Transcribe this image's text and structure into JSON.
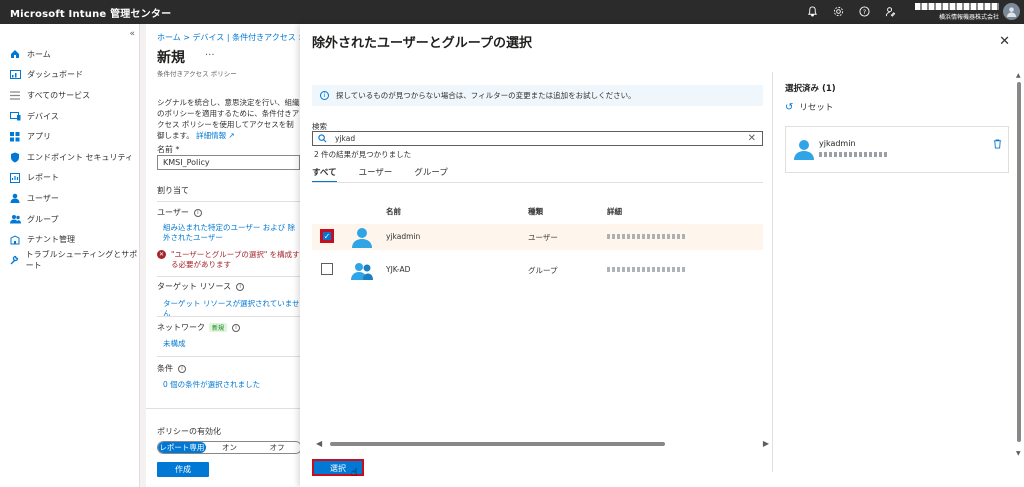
{
  "topbar": {
    "title": "Microsoft Intune 管理センター",
    "org": "横浜情報機器株式会社"
  },
  "nav": {
    "items": [
      {
        "label": "ホーム",
        "icon": "home-icon"
      },
      {
        "label": "ダッシュボード",
        "icon": "dashboard-icon"
      },
      {
        "label": "すべてのサービス",
        "icon": "list-icon"
      },
      {
        "label": "デバイス",
        "icon": "devices-icon"
      },
      {
        "label": "アプリ",
        "icon": "apps-icon"
      },
      {
        "label": "エンドポイント セキュリティ",
        "icon": "shield-icon"
      },
      {
        "label": "レポート",
        "icon": "reports-icon"
      },
      {
        "label": "ユーザー",
        "icon": "user-icon"
      },
      {
        "label": "グループ",
        "icon": "group-icon"
      },
      {
        "label": "テナント管理",
        "icon": "tenant-icon"
      },
      {
        "label": "トラブルシューティングとサポート",
        "icon": "wrench-icon"
      }
    ]
  },
  "policy": {
    "breadcrumb": "ホーム > デバイス | 条件付きアクセス >",
    "title": "新規",
    "subtitle": "条件付きアクセス ポリシー",
    "description": "シグナルを統合し、意思決定を行い、組織のポリシーを適用するために、条件付きアクセス ポリシーを使用してアクセスを制御します。",
    "learn_more": "詳細情報",
    "name_label": "名前 *",
    "name_value": "KMSI_Policy",
    "assignments": "割り当て",
    "users_label": "ユーザー",
    "users_link": "組み込まれた特定のユーザー および 除外されたユーザー",
    "users_error": "\"ユーザーとグループの選択\" を構成する必要があります",
    "target_label": "ターゲット リソース",
    "target_link": "ターゲット リソースが選択されていません",
    "network_label": "ネットワーク",
    "network_badge": "新規",
    "network_link": "未構成",
    "conditions_label": "条件",
    "conditions_link": "0 個の条件が選択されました",
    "enable_label": "ポリシーの有効化",
    "toggle": [
      "レポート専用",
      "オン",
      "オフ"
    ],
    "create_button": "作成"
  },
  "modal": {
    "title": "除外されたユーザーとグループの選択",
    "banner": "探しているものが見つからない場合は、フィルターの変更または追加をお試しください。",
    "search_label": "検索",
    "search_value": "yjkad",
    "results": "2 件の結果が見つかりました",
    "tabs": [
      "すべて",
      "ユーザー",
      "グループ"
    ],
    "columns": [
      "名前",
      "種類",
      "詳細"
    ],
    "rows": [
      {
        "name": "yjkadmin",
        "type": "ユーザー",
        "checked": true
      },
      {
        "name": "YJK-AD",
        "type": "グループ",
        "checked": false
      }
    ],
    "select_button": "選択",
    "selected_title": "選択済み (1)",
    "reset": "リセット",
    "selected_items": [
      {
        "name": "yjkadmin"
      }
    ]
  }
}
